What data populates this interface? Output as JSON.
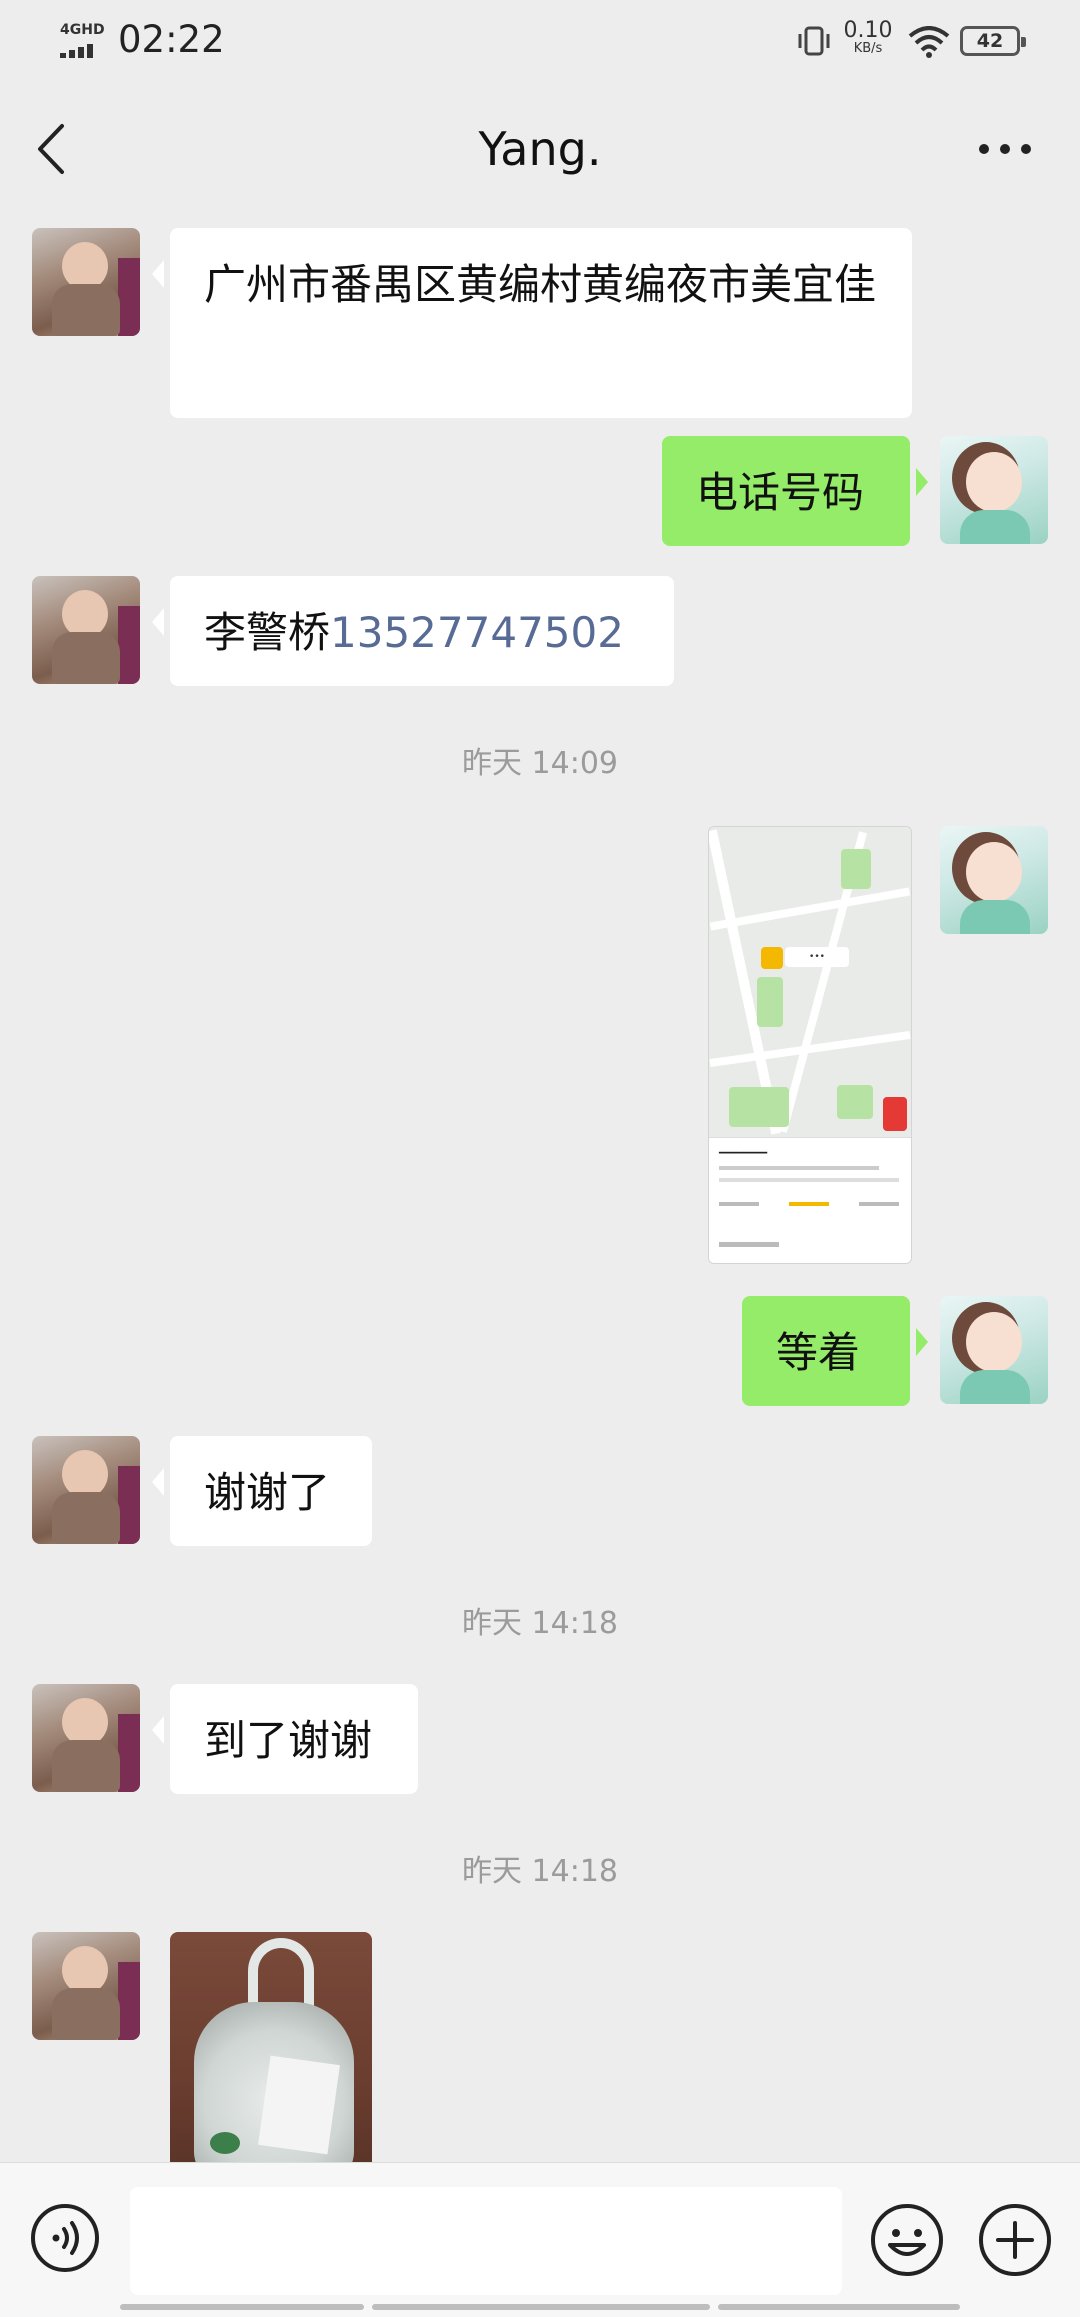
{
  "status_bar": {
    "network": "4GHD",
    "time": "02:22",
    "speed_value": "0.10",
    "speed_unit": "KB/s",
    "battery": "42"
  },
  "header": {
    "title": "Yang.",
    "back_icon": "chevron-left-icon",
    "more_icon": "more-dots-icon"
  },
  "messages": [
    {
      "side": "in",
      "type": "text",
      "text": "广州市番禺区黄编村黄编夜市美宜佳"
    },
    {
      "side": "out",
      "type": "text",
      "text": "电话号码"
    },
    {
      "side": "in",
      "type": "text",
      "name": "李警桥",
      "phone": "13527747502"
    },
    {
      "type": "timestamp",
      "text": "昨天 14:09"
    },
    {
      "side": "out",
      "type": "image",
      "caption": "map-screenshot"
    },
    {
      "side": "out",
      "type": "text",
      "text": "等着"
    },
    {
      "side": "in",
      "type": "text",
      "text": "谢谢了"
    },
    {
      "type": "timestamp",
      "text": "昨天 14:18"
    },
    {
      "side": "in",
      "type": "text",
      "text": "到了谢谢"
    },
    {
      "type": "timestamp",
      "text": "昨天 14:18"
    },
    {
      "side": "in",
      "type": "image",
      "caption": "photo-bag"
    }
  ],
  "input_bar": {
    "voice_icon": "voice-icon",
    "emoji_icon": "emoji-icon",
    "plus_icon": "plus-icon",
    "value": ""
  }
}
